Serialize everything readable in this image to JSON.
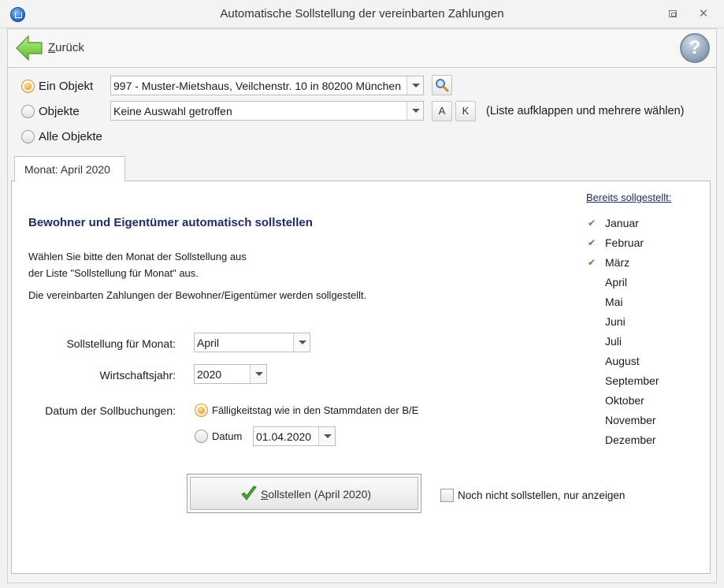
{
  "window": {
    "title": "Automatische Sollstellung der vereinbarten Zahlungen"
  },
  "toolbar": {
    "back_prefix": "Z",
    "back_rest": "urück",
    "help_glyph": "?"
  },
  "objects": {
    "single_label": "Ein Objekt",
    "single_value": "997 - Muster-Mietshaus, Veilchenstr. 10 in 80200 München",
    "multi_label": "Objekte",
    "multi_value": "Keine Auswahl getroffen",
    "btn_a": "A",
    "btn_k": "K",
    "multi_hint": "(Liste aufklappen und mehrere wählen)",
    "all_label": "Alle Objekte",
    "selected": "single"
  },
  "tab": {
    "label": "Monat: April 2020"
  },
  "content": {
    "heading": "Bewohner und Eigentümer automatisch sollstellen",
    "line1": "Wählen Sie bitte den Monat der Sollstellung aus",
    "line2": "der Liste \"Sollstellung für Monat\" aus.",
    "line3": "Die vereinbarten Zahlungen  der Bewohner/Eigentümer werden sollgestellt."
  },
  "form": {
    "month_label": "Sollstellung für Monat:",
    "month_value": "April",
    "year_label": "Wirtschaftsjahr:",
    "year_value": "2020",
    "date_label": "Datum der Sollbuchungen:",
    "opt_due": "Fälligkeitstag wie in den Stammdaten der B/E",
    "opt_date": "Datum",
    "date_value": "01.04.2020",
    "selected_option": "due"
  },
  "already": {
    "title": "Bereits sollgestellt:",
    "months": [
      {
        "name": "Januar",
        "done": true
      },
      {
        "name": "Februar",
        "done": true
      },
      {
        "name": "März",
        "done": true
      },
      {
        "name": "April",
        "done": false
      },
      {
        "name": "Mai",
        "done": false
      },
      {
        "name": "Juni",
        "done": false
      },
      {
        "name": "Juli",
        "done": false
      },
      {
        "name": "August",
        "done": false
      },
      {
        "name": "September",
        "done": false
      },
      {
        "name": "Oktober",
        "done": false
      },
      {
        "name": "November",
        "done": false
      },
      {
        "name": "Dezember",
        "done": false
      }
    ],
    "check_glyph": "✔"
  },
  "actions": {
    "submit_prefix": "S",
    "submit_rest": "ollstellen (April 2020)",
    "preview_label": "Noch nicht sollstellen, nur anzeigen",
    "preview_checked": false
  },
  "colors": {
    "accent_heading": "#1f2a6b",
    "check_green": "#3e9a2c",
    "radio_selected": "#f2a816"
  }
}
